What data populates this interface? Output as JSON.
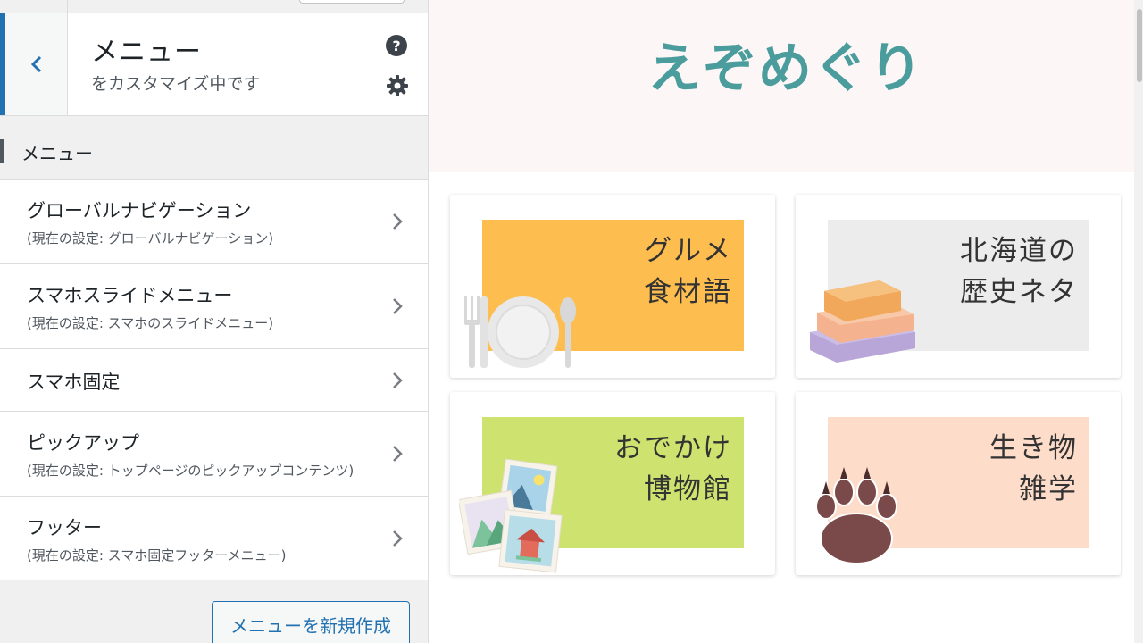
{
  "sidebar": {
    "header": {
      "title": "メニュー",
      "subtitle": "をカスタマイズ中です",
      "help_glyph": "?"
    },
    "section_title": "メニュー",
    "items": [
      {
        "label": "グローバルナビゲーション",
        "sub": "(現在の設定: グローバルナビゲーション)"
      },
      {
        "label": "スマホスライドメニュー",
        "sub": "(現在の設定: スマホのスライドメニュー)"
      },
      {
        "label": "スマホ固定",
        "sub": ""
      },
      {
        "label": "ピックアップ",
        "sub": "(現在の設定: トップページのピックアップコンテンツ)"
      },
      {
        "label": "フッター",
        "sub": "(現在の設定: スマホ固定フッターメニュー)"
      }
    ],
    "create_button": "メニューを新規作成"
  },
  "preview": {
    "site_title": "えぞめぐり",
    "cards": [
      {
        "line1": "グルメ",
        "line2": "食材語",
        "bg": "#fdbd4f",
        "illustration": "plate-cutlery-icon"
      },
      {
        "line1": "北海道の",
        "line2": "歴史ネタ",
        "bg": "#ececec",
        "illustration": "books-icon"
      },
      {
        "line1": "おでかけ",
        "line2": "博物館",
        "bg": "#cde26f",
        "illustration": "photos-icon"
      },
      {
        "line1": "生き物",
        "line2": "雑学",
        "bg": "#fddcc9",
        "illustration": "paw-icon"
      }
    ]
  },
  "colors": {
    "accent": "#2271b1",
    "site_title": "#4a9d9c"
  }
}
